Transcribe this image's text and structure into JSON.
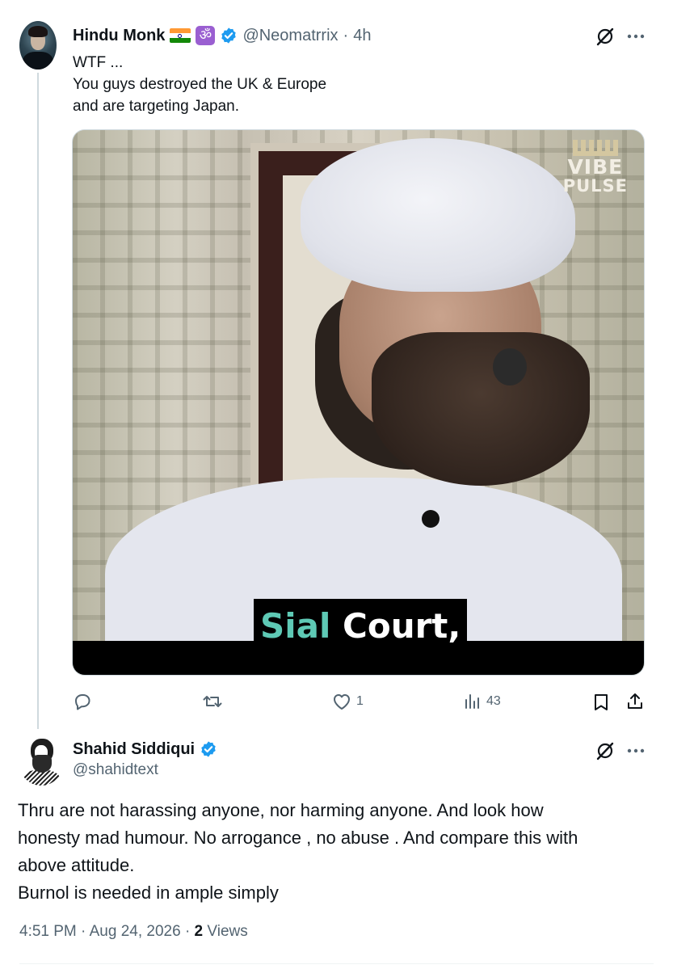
{
  "post": {
    "author_name": "Hindu Monk",
    "flag_icon": "india-flag-icon",
    "badge_icon": "om-icon",
    "badge_glyph": "ॐ",
    "handle": "@Neomatrrix",
    "separator": "·",
    "time": "4h",
    "text_lines": [
      "WTF ...",
      "You guys destroyed the UK & Europe",
      "and are targeting Japan."
    ],
    "media": {
      "watermark_line1": "VIBE",
      "watermark_line2": "PULSE",
      "subtitle_highlight": "Sial",
      "subtitle_rest": "Court,"
    },
    "actions": {
      "replies": "",
      "reposts": "",
      "likes": "1",
      "views": "43"
    }
  },
  "reply": {
    "author_name": "Shahid Siddiqui",
    "handle": "@shahidtext",
    "text_lines": [
      "Thru are not harassing anyone, nor harming anyone. And look how",
      "honesty mad humour. No arrogance , no abuse . And compare this with",
      "above attitude.",
      "Burnol is needed in ample simply"
    ],
    "time": "4:51 PM",
    "sep1": "·",
    "date": "Aug 24, 2026",
    "sep2": "·",
    "view_count": "2",
    "views_label": "Views"
  },
  "colors": {
    "text": "#0f1419",
    "secondary": "#536471",
    "verified": "#1d9bf0",
    "subtitle_accent": "#5ec9b5"
  }
}
